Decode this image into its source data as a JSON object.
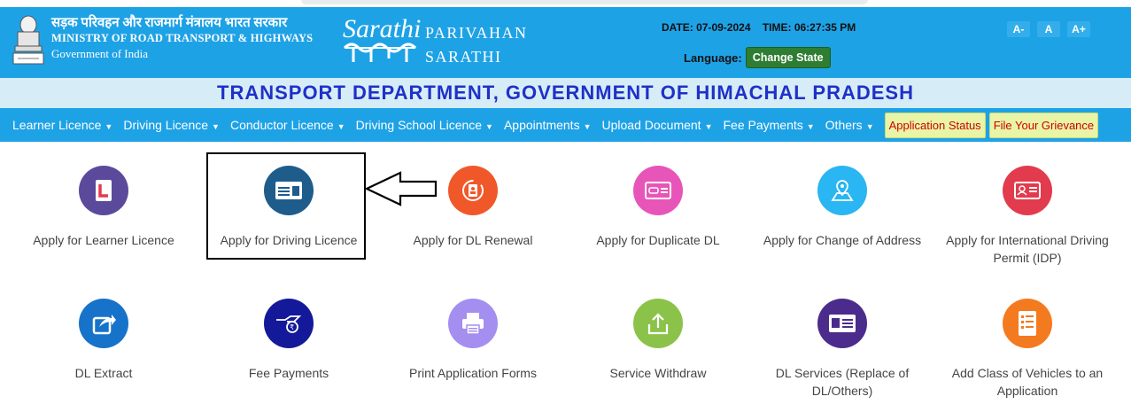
{
  "header": {
    "ministry_hindi": "सड़क परिवहन और राजमार्ग मंत्रालय भारत सरकार",
    "ministry_english": "MINISTRY OF ROAD TRANSPORT & HIGHWAYS",
    "government": "Government of India",
    "logo_text": "Sarathi",
    "brand_line1": "PARIVAHAN",
    "brand_line2": "SARATHI",
    "date_label": "DATE: 07-09-2024",
    "time_label": "TIME: 06:27:35 PM",
    "language_label": "Language:",
    "change_state": "Change State",
    "font_small": "A-",
    "font_normal": "A",
    "font_large": "A+"
  },
  "department_title": "TRANSPORT DEPARTMENT, GOVERNMENT OF HIMACHAL PRADESH",
  "nav": {
    "items": [
      "Learner Licence",
      "Driving Licence",
      "Conductor Licence",
      "Driving School Licence",
      "Appointments",
      "Upload Document",
      "Fee Payments",
      "Others"
    ],
    "application_status": "Application Status",
    "grievance": "File Your Grievance"
  },
  "tiles": [
    {
      "label": "Apply for Learner Licence",
      "icon": "learner-licence-icon",
      "color": "#5b4a9b"
    },
    {
      "label": "Apply for Driving Licence",
      "icon": "driving-licence-icon",
      "color": "#1e5c8c"
    },
    {
      "label": "Apply for DL Renewal",
      "icon": "dl-renewal-icon",
      "color": "#f0582a"
    },
    {
      "label": "Apply for Duplicate DL",
      "icon": "duplicate-dl-icon",
      "color": "#e855b8"
    },
    {
      "label": "Apply for Change of Address",
      "icon": "change-address-icon",
      "color": "#29b6f2"
    },
    {
      "label": "Apply for International Driving Permit (IDP)",
      "icon": "idp-icon",
      "color": "#e23b4e"
    },
    {
      "label": "DL Extract",
      "icon": "dl-extract-icon",
      "color": "#1673c9"
    },
    {
      "label": "Fee Payments",
      "icon": "fee-payment-icon",
      "color": "#14199a"
    },
    {
      "label": "Print Application Forms",
      "icon": "print-icon",
      "color": "#a48ef0"
    },
    {
      "label": "Service Withdraw",
      "icon": "service-withdraw-icon",
      "color": "#8bc34a"
    },
    {
      "label": "DL Services (Replace of DL/Others)",
      "icon": "dl-services-icon",
      "color": "#4b2c8c"
    },
    {
      "label": "Add Class of Vehicles to an Application",
      "icon": "add-class-icon",
      "color": "#f47a20"
    }
  ]
}
